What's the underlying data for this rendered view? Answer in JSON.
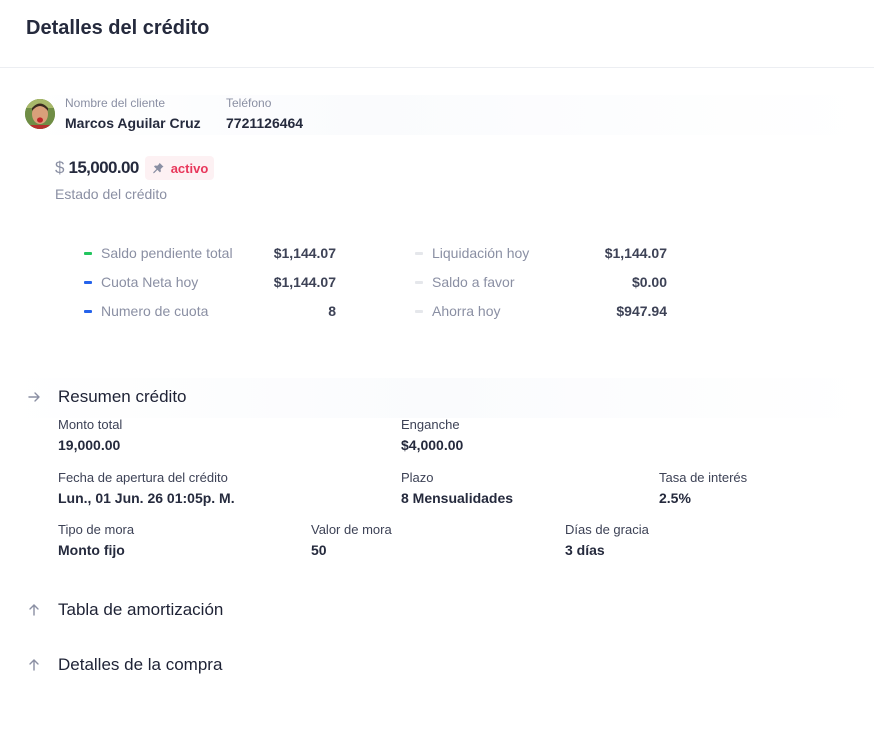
{
  "header": {
    "title": "Detalles del crédito"
  },
  "client": {
    "name_label": "Nombre del cliente",
    "name": "Marcos Aguilar Cruz",
    "phone_label": "Teléfono",
    "phone": "7721126464"
  },
  "credit": {
    "currency_symbol": "$",
    "amount": "15,000.00",
    "status": "activo",
    "status_caption": "Estado del crédito",
    "status_color": "#e8375b"
  },
  "metrics_left": [
    {
      "label": "Saldo pendiente total",
      "value": "$1,144.07",
      "color": "#22c55e"
    },
    {
      "label": "Cuota Neta hoy",
      "value": "$1,144.07",
      "color": "#2563eb"
    },
    {
      "label": "Numero de cuota",
      "value": "8",
      "color": "#2563eb"
    }
  ],
  "metrics_right": [
    {
      "label": "Liquidación hoy",
      "value": "$1,144.07",
      "color": "#e5e7eb"
    },
    {
      "label": "Saldo a favor",
      "value": "$0.00",
      "color": "#e5e7eb"
    },
    {
      "label": "Ahorra hoy",
      "value": "$947.94",
      "color": "#e5e7eb"
    }
  ],
  "resumen": {
    "title": "Resumen crédito",
    "monto_total_label": "Monto total",
    "monto_total": "19,000.00",
    "enganche_label": "Enganche",
    "enganche": "$4,000.00",
    "fecha_label": "Fecha de apertura del crédito",
    "fecha": "Lun., 01 Jun. 26 01:05p. M.",
    "plazo_label": "Plazo",
    "plazo": "8 Mensualidades",
    "tasa_label": "Tasa de interés",
    "tasa": "2.5%",
    "tipo_mora_label": "Tipo de mora",
    "tipo_mora": "Monto fijo",
    "valor_mora_label": "Valor de mora",
    "valor_mora": "50",
    "dias_gracia_label": "Días de gracia",
    "dias_gracia": "3 días"
  },
  "sections": {
    "amortizacion": "Tabla de amortización",
    "compra": "Detalles de la compra"
  },
  "icons": {
    "resumen": "arrow-right-icon",
    "amortizacion": "arrow-up-icon",
    "compra": "arrow-up-icon",
    "status": "pin-icon"
  }
}
